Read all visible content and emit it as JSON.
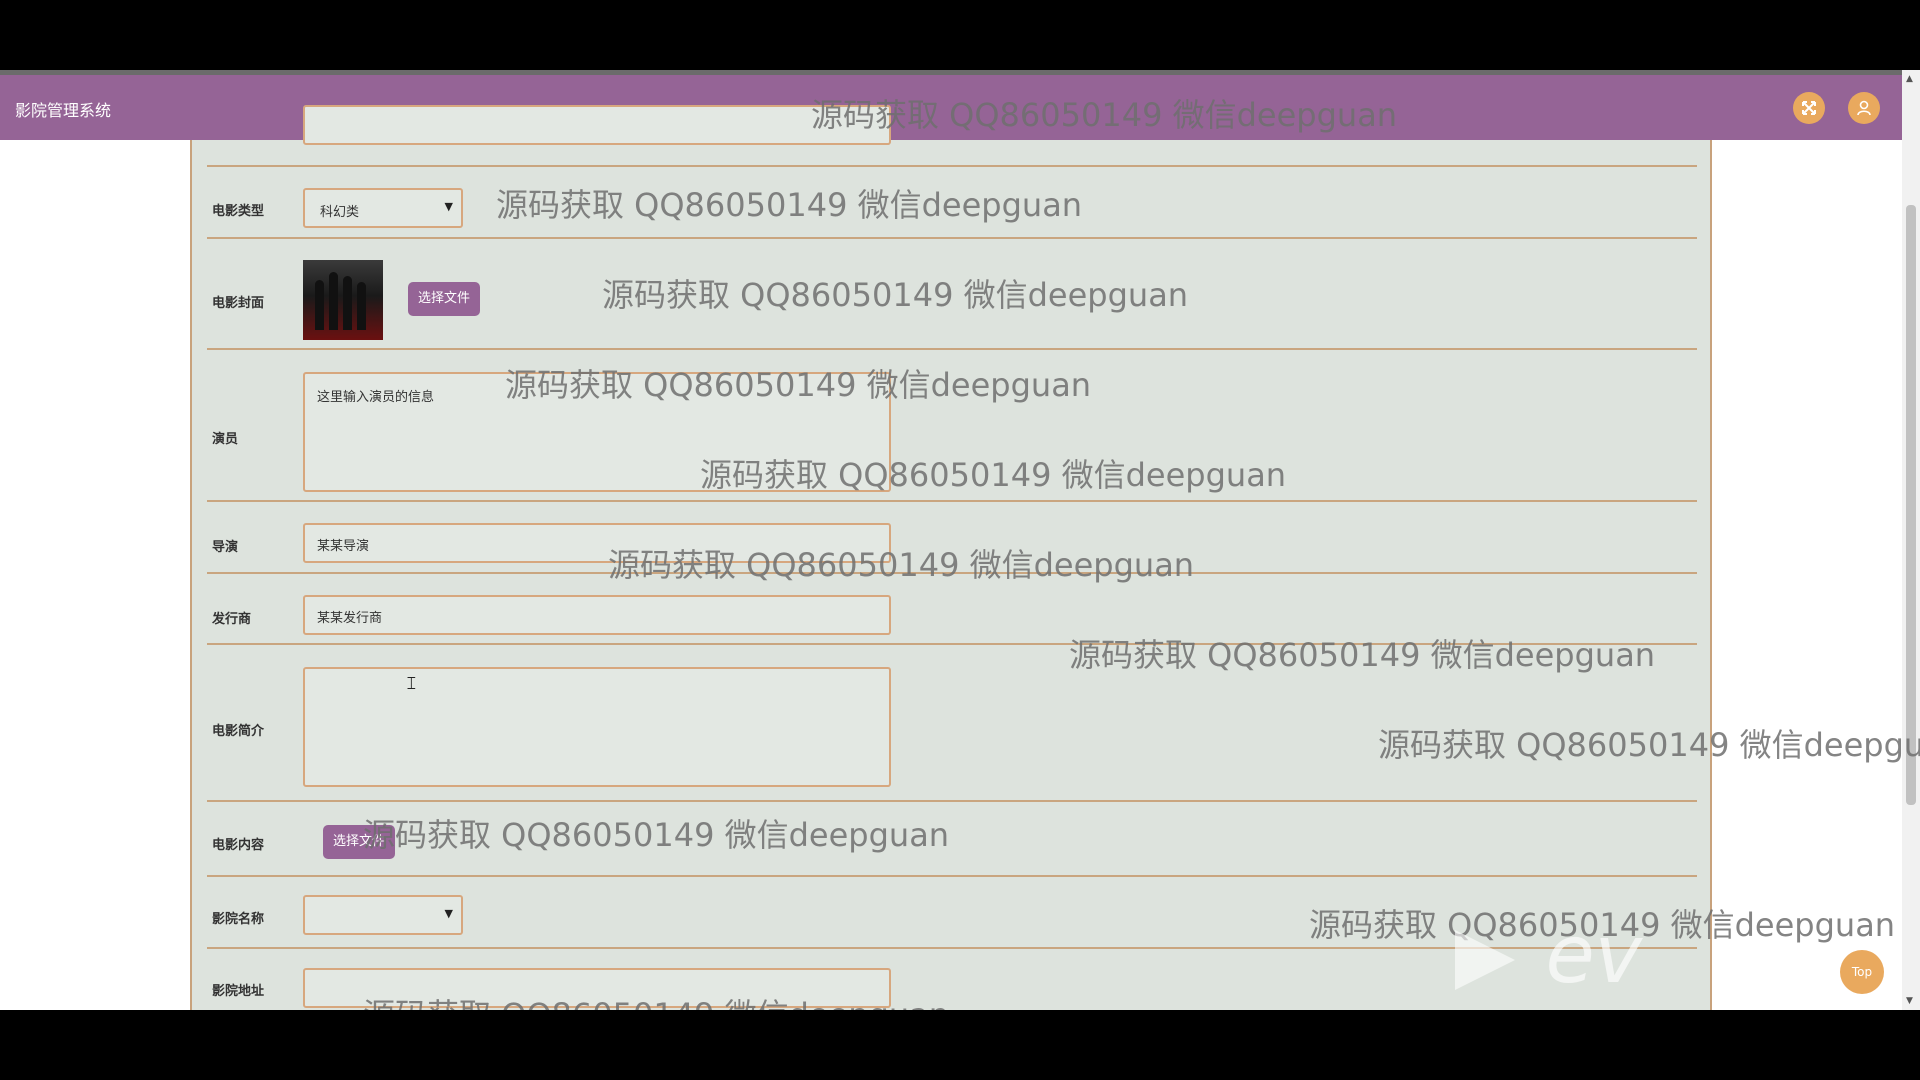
{
  "app": {
    "title": "影院管理系统"
  },
  "watermark": "源码获取 QQ86050149 微信deepguan",
  "form": {
    "movie_type": {
      "label": "电影类型",
      "value": "科幻类"
    },
    "cover": {
      "label": "电影封面",
      "button": "选择文件"
    },
    "actors": {
      "label": "演员",
      "value": "这里输入演员的信息"
    },
    "director": {
      "label": "导演",
      "value": "某某导演"
    },
    "distributor": {
      "label": "发行商",
      "value": "某某发行商"
    },
    "synopsis": {
      "label": "电影简介",
      "value": ""
    },
    "content": {
      "label": "电影内容",
      "button": "选择文件"
    },
    "cinema_name": {
      "label": "影院名称",
      "value": ""
    },
    "cinema_address": {
      "label": "影院地址",
      "value": ""
    }
  },
  "top_button": "Top",
  "logo_text": "ev",
  "colors": {
    "topbar": "#956496",
    "accent": "#e9a95e",
    "panel": "#dde3dd",
    "border": "#c9a57f"
  }
}
